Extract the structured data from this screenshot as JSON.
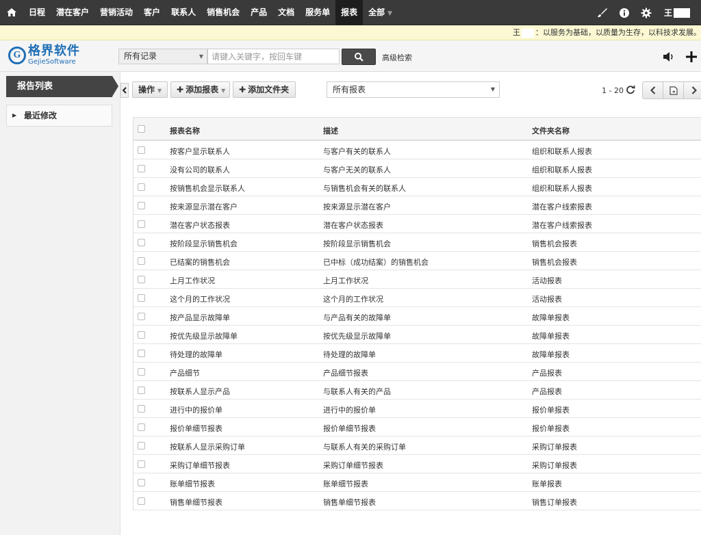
{
  "topnav": {
    "items": [
      {
        "label": "日程",
        "name": "nav-schedule"
      },
      {
        "label": "潜在客户",
        "name": "nav-leads"
      },
      {
        "label": "营销活动",
        "name": "nav-campaigns"
      },
      {
        "label": "客户",
        "name": "nav-accounts"
      },
      {
        "label": "联系人",
        "name": "nav-contacts"
      },
      {
        "label": "销售机会",
        "name": "nav-opportunities"
      },
      {
        "label": "产品",
        "name": "nav-products"
      },
      {
        "label": "文档",
        "name": "nav-documents"
      },
      {
        "label": "服务单",
        "name": "nav-service-orders"
      },
      {
        "label": "报表",
        "name": "nav-reports",
        "active": true
      },
      {
        "label": "全部",
        "name": "nav-all",
        "dropdown": true
      }
    ],
    "user": "王",
    "icons": [
      "home-icon",
      "paintbrush-icon",
      "info-icon",
      "gear-icon"
    ]
  },
  "motto": {
    "user": "王",
    "text": "：以服务为基础，以质量为生存，以科技求发展。"
  },
  "header": {
    "logo_cn": "格界软件",
    "logo_en": "GejieSoftware",
    "logo_letter": "G",
    "scope": "所有记录",
    "search_placeholder": "请键入关键字，按回车键",
    "advanced_search": "高级检索",
    "icons": [
      "search-icon",
      "speaker-icon",
      "plus-icon"
    ]
  },
  "sidebar": {
    "title": "报告列表",
    "items": [
      {
        "label": "最近修改"
      }
    ]
  },
  "toolbar": {
    "actions_label": "操作",
    "add_report_label": "添加报表",
    "add_folder_label": "添加文件夹",
    "filter_value": "所有报表",
    "pager": "1 - 20"
  },
  "table": {
    "headers": [
      "报表名称",
      "描述",
      "文件夹名称"
    ],
    "rows": [
      [
        "按客户显示联系人",
        "与客户有关的联系人",
        "组织和联系人报表"
      ],
      [
        "没有公司的联系人",
        "与客户无关的联系人",
        "组织和联系人报表"
      ],
      [
        "按销售机会显示联系人",
        "与销售机会有关的联系人",
        "组织和联系人报表"
      ],
      [
        "按来源显示潜在客户",
        "按来源显示潜在客户",
        "潜在客户线索报表"
      ],
      [
        "潜在客户状态报表",
        "潜在客户状态报表",
        "潜在客户线索报表"
      ],
      [
        "按阶段显示销售机会",
        "按阶段显示销售机会",
        "销售机会报表"
      ],
      [
        "已结案的销售机会",
        "已中标（成功结案）的销售机会",
        "销售机会报表"
      ],
      [
        "上月工作状况",
        "上月工作状况",
        "活动报表"
      ],
      [
        "这个月的工作状况",
        "这个月的工作状况",
        "活动报表"
      ],
      [
        "按产品显示故障单",
        "与产品有关的故障单",
        "故障单报表"
      ],
      [
        "按优先级显示故障单",
        "按优先级显示故障单",
        "故障单报表"
      ],
      [
        "待处理的故障单",
        "待处理的故障单",
        "故障单报表"
      ],
      [
        "产品细节",
        "产品细节报表",
        "产品报表"
      ],
      [
        "按联系人显示产品",
        "与联系人有关的产品",
        "产品报表"
      ],
      [
        "进行中的报价单",
        "进行中的报价单",
        "报价单报表"
      ],
      [
        "报价单细节报表",
        "报价单细节报表",
        "报价单报表"
      ],
      [
        "按联系人显示采购订单",
        "与联系人有关的采购订单",
        "采购订单报表"
      ],
      [
        "采购订单细节报表",
        "采购订单细节报表",
        "采购订单报表"
      ],
      [
        "账单细节报表",
        "账单细节报表",
        "账单报表"
      ],
      [
        "销售单细节报表",
        "销售单细节报表",
        "销售订单报表"
      ]
    ]
  }
}
